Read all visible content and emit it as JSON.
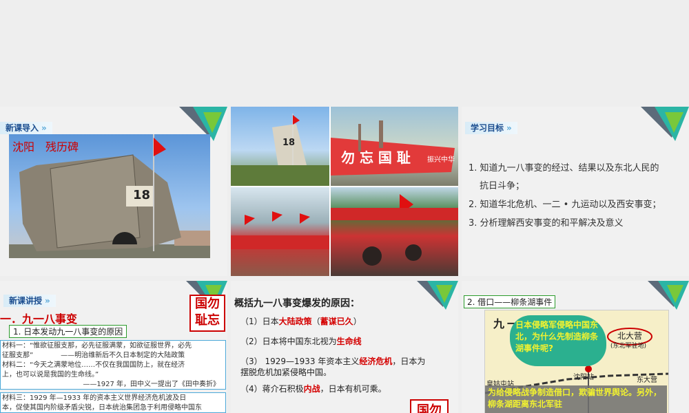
{
  "slide1": {
    "tag": "新课导入",
    "photo_caption": "沈阳　残历碑",
    "monument_number": "18"
  },
  "slide2": {
    "banner_text": "勿 忘 国 耻",
    "banner_text_end": "振兴中华",
    "monument_number": "18"
  },
  "slide3": {
    "tag": "学习目标",
    "goals": [
      "1. 知道九一八事变的经过、结果以及东北人民的",
      "抗日斗争；",
      "2. 知道华北危机、一二 • 九运动以及西安事变；",
      "3. 分析理解西安事变的和平解决及意义"
    ]
  },
  "slide4": {
    "tag": "新课讲授",
    "heading": "一．九一八事变",
    "subheading": "1. 日本发动九一八事变的原因",
    "seal": [
      "国",
      "勿",
      "耻",
      "忘"
    ],
    "material_box1": [
      "材料一：“惟欲征服支那，必先征服满蒙，如欲征服世界，必先",
      "征服支那”　　　　——明治维新后不久日本制定的大陆政策",
      "材料二：“今天之满蒙地位……不仅在我国国防上，就在经济",
      "上，也可以说是我国的生命线。”",
      "——1927 年，田中义一提出了《田中奏折》"
    ],
    "material_box2": [
      "材料三：1929 年—1933 年的资本主义世界经济危机波及日",
      "本，促使其国内阶级矛盾尖锐，日本统治集团急于利用侵略中国东"
    ]
  },
  "slide5": {
    "question": "概括九一八事变爆发的原因：",
    "items": [
      {
        "prefix": "（1）日本",
        "hl1": "大陆政策",
        "mid": "（",
        "hl2": "蓄谋已久",
        "suffix": "）"
      },
      {
        "prefix": "（2）日本将中国东北视为",
        "hl1": "生命线",
        "mid": "",
        "hl2": "",
        "suffix": ""
      },
      {
        "prefix": "（3） 1929—1933 年资本主义",
        "hl1": "经济危机",
        "mid": "，日本为",
        "hl2": "",
        "suffix": ""
      },
      {
        "prefix": "摆脱危机加紧侵略中国。",
        "hl1": "",
        "mid": "",
        "hl2": "",
        "suffix": ""
      },
      {
        "prefix": "（4）蒋介石积极",
        "hl1": "内战",
        "mid": "，日本有机可乘。",
        "hl2": "",
        "suffix": ""
      }
    ],
    "seal": "国勿"
  },
  "slide6": {
    "tag": "2. 借口——柳条湖事件",
    "map_title": "九一八",
    "beidaying": "北大营",
    "beidaying_sub": "(东北军驻地)",
    "station1": "皇姑屯站",
    "station2": "沈阳站",
    "station3": "东大营",
    "question": "日本侵略军侵略中国东北，为什么先制造柳条湖事件呢?",
    "answer": "为给侵略战争制造借口，欺骗世界舆论。另外，柳条湖距离东北军驻"
  },
  "colors": {
    "accent_red": "#d40000",
    "teal": "#2bb5a5",
    "green": "#79c83a",
    "blue_tag": "#1b4d8f"
  }
}
